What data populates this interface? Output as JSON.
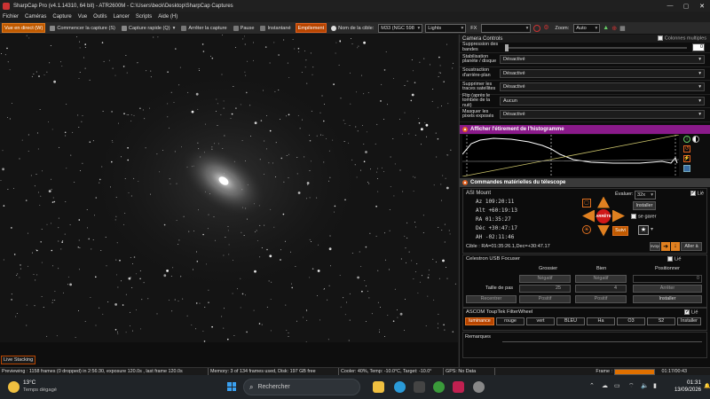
{
  "titlebar": {
    "title": "SharpCap Pro (v4.1.14310, 64 bit) - ATR2600M - C:\\Users\\beck\\Desktop\\SharpCap Captures",
    "minimize": "—",
    "maximize": "▢",
    "close": "✕"
  },
  "menu": [
    "Fichier",
    "Caméras",
    "Capture",
    "Vue",
    "Outils",
    "Lancer",
    "Scripts",
    "Aide (H)"
  ],
  "toolbar": {
    "live": "Vue en direct (W)",
    "start_capture": "Commencer la capture (S)",
    "quick_capture": "Capture rapide (Q)",
    "stop_capture": "Arrêter la capture",
    "pause": "Pause",
    "snapshot": "Instantané",
    "stacking": "Empilement",
    "target_label": "Nom de la cible:",
    "target_value": "M33 (NGC 598",
    "frame_type": "Lights",
    "fx_label": "FX",
    "zoom_label": "Zoom:",
    "zoom_value": "Auto"
  },
  "panel": {
    "title": "Camera Controls",
    "multi_columns": "Colonnes multiples",
    "banding_label": "Suppression des bandes",
    "banding_value": "0",
    "rows": [
      {
        "label": "Stabilisation planète / disque",
        "value": "Désactivé"
      },
      {
        "label": "Soustraction d'arrière-plan",
        "value": "Désactivé"
      },
      {
        "label": "Supprimer les traces satellites",
        "value": "Désactivé"
      },
      {
        "label": "Flip (après le tombée de la nuit)",
        "value": "Aucun"
      },
      {
        "label": "Masquer les pixels exposés",
        "value": "Désactivé"
      }
    ],
    "histogram_header": "Afficher l'étirement de l'histogramme",
    "telescope_header": "Commandes matérielles du télescope",
    "mount": {
      "name": "ASI Mount",
      "linked": "Lié",
      "az": "Az     109:20:11",
      "alt": "Alt  +60:19:13",
      "ra": "RA     01:35:27",
      "dec": "Déc  +30:47:17",
      "ah": "AH   -02:11:46",
      "target": "Cible : RA=01:35:26.1,Dec=+30:47.17",
      "evaluate_label": "Évaluer:",
      "evaluate_value": "32x",
      "install": "Installer",
      "park": "se garer",
      "stop": "ARRÊTE",
      "follow": "Suivi",
      "goto": "Aller à",
      "send": "Envoyer"
    },
    "focuser": {
      "name": "Celestron USB Focuser",
      "linked": "Lié",
      "coarse": "Grossier",
      "fine": "Bien",
      "positioner": "Positionner",
      "negative": "Négatif",
      "positive": "Positif",
      "position_value": "0",
      "step_label": "Taille de pas",
      "coarse_step": "25",
      "fine_step": "4",
      "stop": "Arrêter",
      "recenter": "Recentrer",
      "install": "Installer"
    },
    "filterwheel": {
      "name": "ASCOM ToupTek FilterWheel",
      "linked": "Lié",
      "filters": [
        "luminance",
        "rouge",
        "vert",
        "BLEU",
        "Ha",
        "O3",
        "S2"
      ],
      "install": "Installer"
    },
    "remarks": "Remarques"
  },
  "live_stacking": "Live Stacking",
  "status": {
    "previewing": "Previewing : 1158 frames (0 dropped) in 2:56:30, exposure 120.0s , last frame 120.0s",
    "memory": "Memory: 3 of 134 frames used, Disk: 197 GB free",
    "cooler": "Cooler: 40%, Temp: -10.0°C, Target: -10.0°",
    "gps": "GPS: No Data",
    "frame_label": "Frame :",
    "frame_progress": 1.0,
    "elapsed": "01:17/00:43"
  },
  "taskbar": {
    "temp": "13°C",
    "weather": "Temps dégagé",
    "search": "Rechercher",
    "time": "01:31",
    "date": "13/09/2026"
  },
  "colors": {
    "accent": "#c05a00",
    "purple": "#8a1a8a",
    "stop_red": "#d01818"
  }
}
